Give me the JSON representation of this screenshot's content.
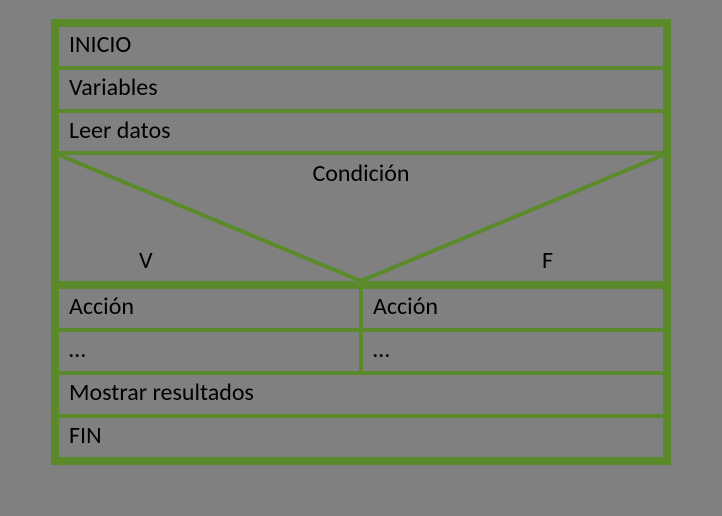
{
  "rows": {
    "inicio": "INICIO",
    "variables": "Variables",
    "leer": "Leer datos",
    "mostrar": "Mostrar resultados",
    "fin": "FIN"
  },
  "condition": {
    "label": "Condición",
    "true_label": "V",
    "false_label": "F"
  },
  "branches": {
    "true": [
      "Acción",
      "…"
    ],
    "false": [
      "Acción",
      "…"
    ]
  },
  "colors": {
    "border": "#5b8a2a",
    "background": "#808080"
  }
}
